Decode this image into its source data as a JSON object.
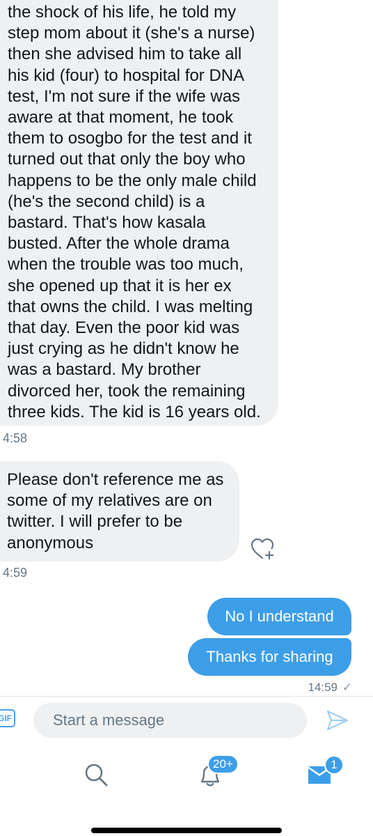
{
  "conversation": {
    "incoming": [
      {
        "lines": [
          "the shock of his life, he told my",
          "step mom about it (she's a nurse)",
          "then she advised him to take all",
          "his kid (four) to hospital for DNA",
          "test, I'm not sure if the wife was",
          "aware at that moment, he took",
          "them to osogbo for the test and it",
          "turned out that only the boy who",
          "happens to be the only male child",
          "(he's the second child) is a",
          "bastard. That's how kasala",
          "busted. After the whole drama",
          "when the trouble was too much,",
          "she opened up that it is her ex",
          "that owns the child. I was melting",
          "that day. Even the poor kid was",
          "just crying as he didn't know he",
          "was a bastard. My brother",
          "divorced her, took the remaining",
          "three kids. The kid is 16 years old."
        ],
        "time": "4:58"
      },
      {
        "lines": [
          "Please don't reference me as",
          "some of my relatives are on",
          "twitter. I will prefer to be",
          "anonymous"
        ],
        "time": "4:59"
      }
    ],
    "outgoing": [
      {
        "text": "No I understand"
      },
      {
        "text": "Thanks for sharing"
      }
    ],
    "outgoing_time": "14:59",
    "read_mark": "✓"
  },
  "composer": {
    "gif_label": "GIF",
    "placeholder": "Start a message",
    "send_icon": "send-icon"
  },
  "tabbar": {
    "search_icon": "search-icon",
    "notifications_icon": "bell-icon",
    "notifications_badge": "20+",
    "messages_icon": "envelope-icon",
    "messages_badge": "1"
  },
  "colors": {
    "accent": "#3d9ee8",
    "incoming_bubble": "#eef0f2",
    "meta_text": "#657786"
  }
}
